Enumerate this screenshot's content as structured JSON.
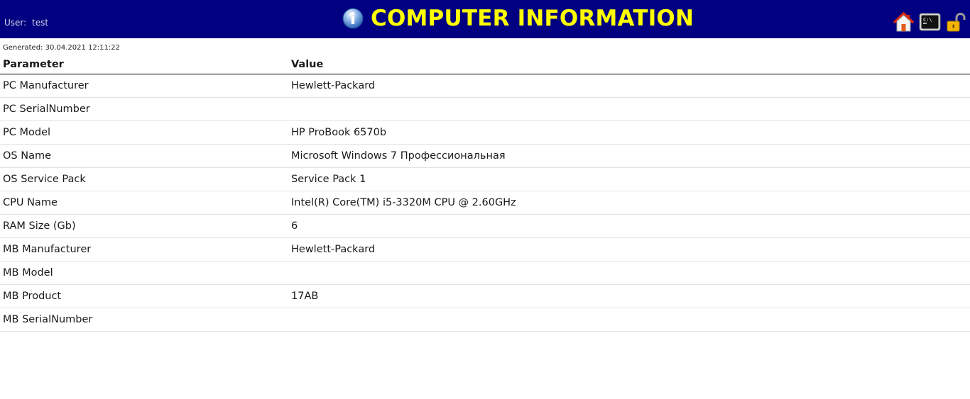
{
  "header": {
    "user_label": "User:",
    "user_name": "test",
    "title": "COMPUTER INFORMATION",
    "icons": [
      "info-icon",
      "home-icon",
      "console-icon",
      "unlock-icon"
    ]
  },
  "generated": "Generated: 30.04.2021 12:11:22",
  "table": {
    "columns": [
      "Parameter",
      "Value"
    ],
    "rows": [
      {
        "param": "PC Manufacturer",
        "value": "Hewlett-Packard"
      },
      {
        "param": "PC SerialNumber",
        "value": ""
      },
      {
        "param": "PC Model",
        "value": "HP ProBook 6570b"
      },
      {
        "param": "OS Name",
        "value": "Microsoft Windows 7 Профессиональная"
      },
      {
        "param": "OS Service Pack",
        "value": "Service Pack 1"
      },
      {
        "param": "CPU Name",
        "value": "Intel(R) Core(TM) i5-3320M CPU @ 2.60GHz"
      },
      {
        "param": "RAM Size (Gb)",
        "value": "6"
      },
      {
        "param": "MB Manufacturer",
        "value": "Hewlett-Packard"
      },
      {
        "param": "MB Model",
        "value": ""
      },
      {
        "param": "MB Product",
        "value": "17AB"
      },
      {
        "param": "MB SerialNumber",
        "value": ""
      }
    ]
  },
  "colors": {
    "header_bg": "#000080",
    "title": "#ffff00"
  }
}
